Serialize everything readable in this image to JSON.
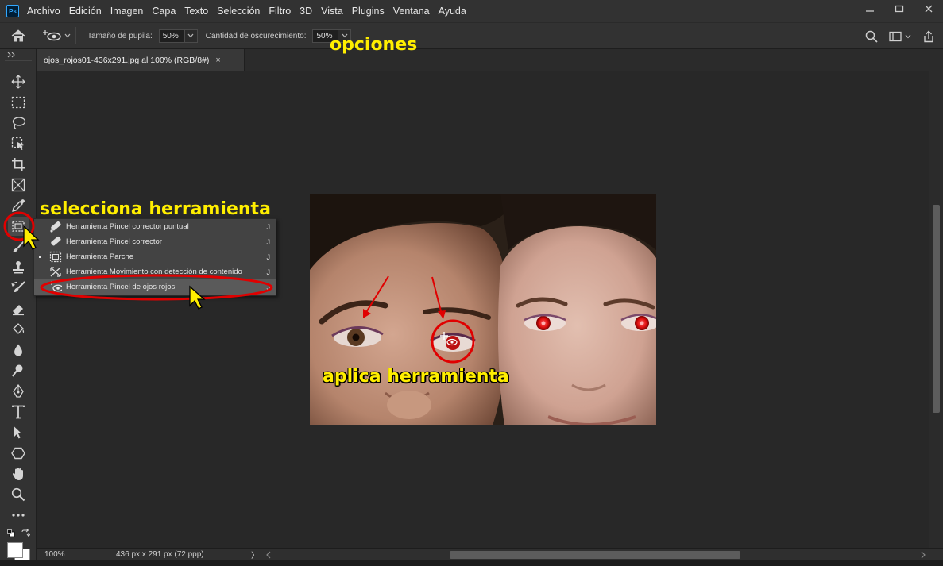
{
  "app": {
    "logo_text": "Ps"
  },
  "menubar": {
    "items": [
      "Archivo",
      "Edición",
      "Imagen",
      "Capa",
      "Texto",
      "Selección",
      "Filtro",
      "3D",
      "Vista",
      "Plugins",
      "Ventana",
      "Ayuda"
    ]
  },
  "options": {
    "pupil_size_label": "Tamaño de pupila:",
    "pupil_size_value": "50%",
    "darken_amount_label": "Cantidad de oscurecimiento:",
    "darken_amount_value": "50%"
  },
  "document": {
    "tab_title": "ojos_rojos01-436x291.jpg al 100% (RGB/8#)",
    "close_glyph": "×"
  },
  "flyout": {
    "items": [
      {
        "label": "Herramienta Pincel corrector puntual",
        "shortcut": "J",
        "icon": "spot-healing-brush-icon"
      },
      {
        "label": "Herramienta Pincel corrector",
        "shortcut": "J",
        "icon": "healing-brush-icon"
      },
      {
        "label": "Herramienta Parche",
        "shortcut": "J",
        "icon": "patch-icon"
      },
      {
        "label": "Herramienta Movimiento con detección de contenido",
        "shortcut": "J",
        "icon": "content-aware-move-icon"
      },
      {
        "label": "Herramienta Pincel de ojos rojos",
        "shortcut": "J",
        "icon": "red-eye-icon"
      }
    ]
  },
  "status": {
    "zoom": "100%",
    "doc_info": "436 px x 291 px (72 ppp)",
    "arrow_glyph": "〉"
  },
  "annotations": {
    "options": "opciones",
    "select_tool": "selecciona herramienta",
    "apply_tool": "aplica herramienta"
  },
  "colors": {
    "annotation_yellow": "#ffee00",
    "annotation_red": "#e00000",
    "ui_dark": "#323232",
    "canvas_bg": "#282828"
  }
}
